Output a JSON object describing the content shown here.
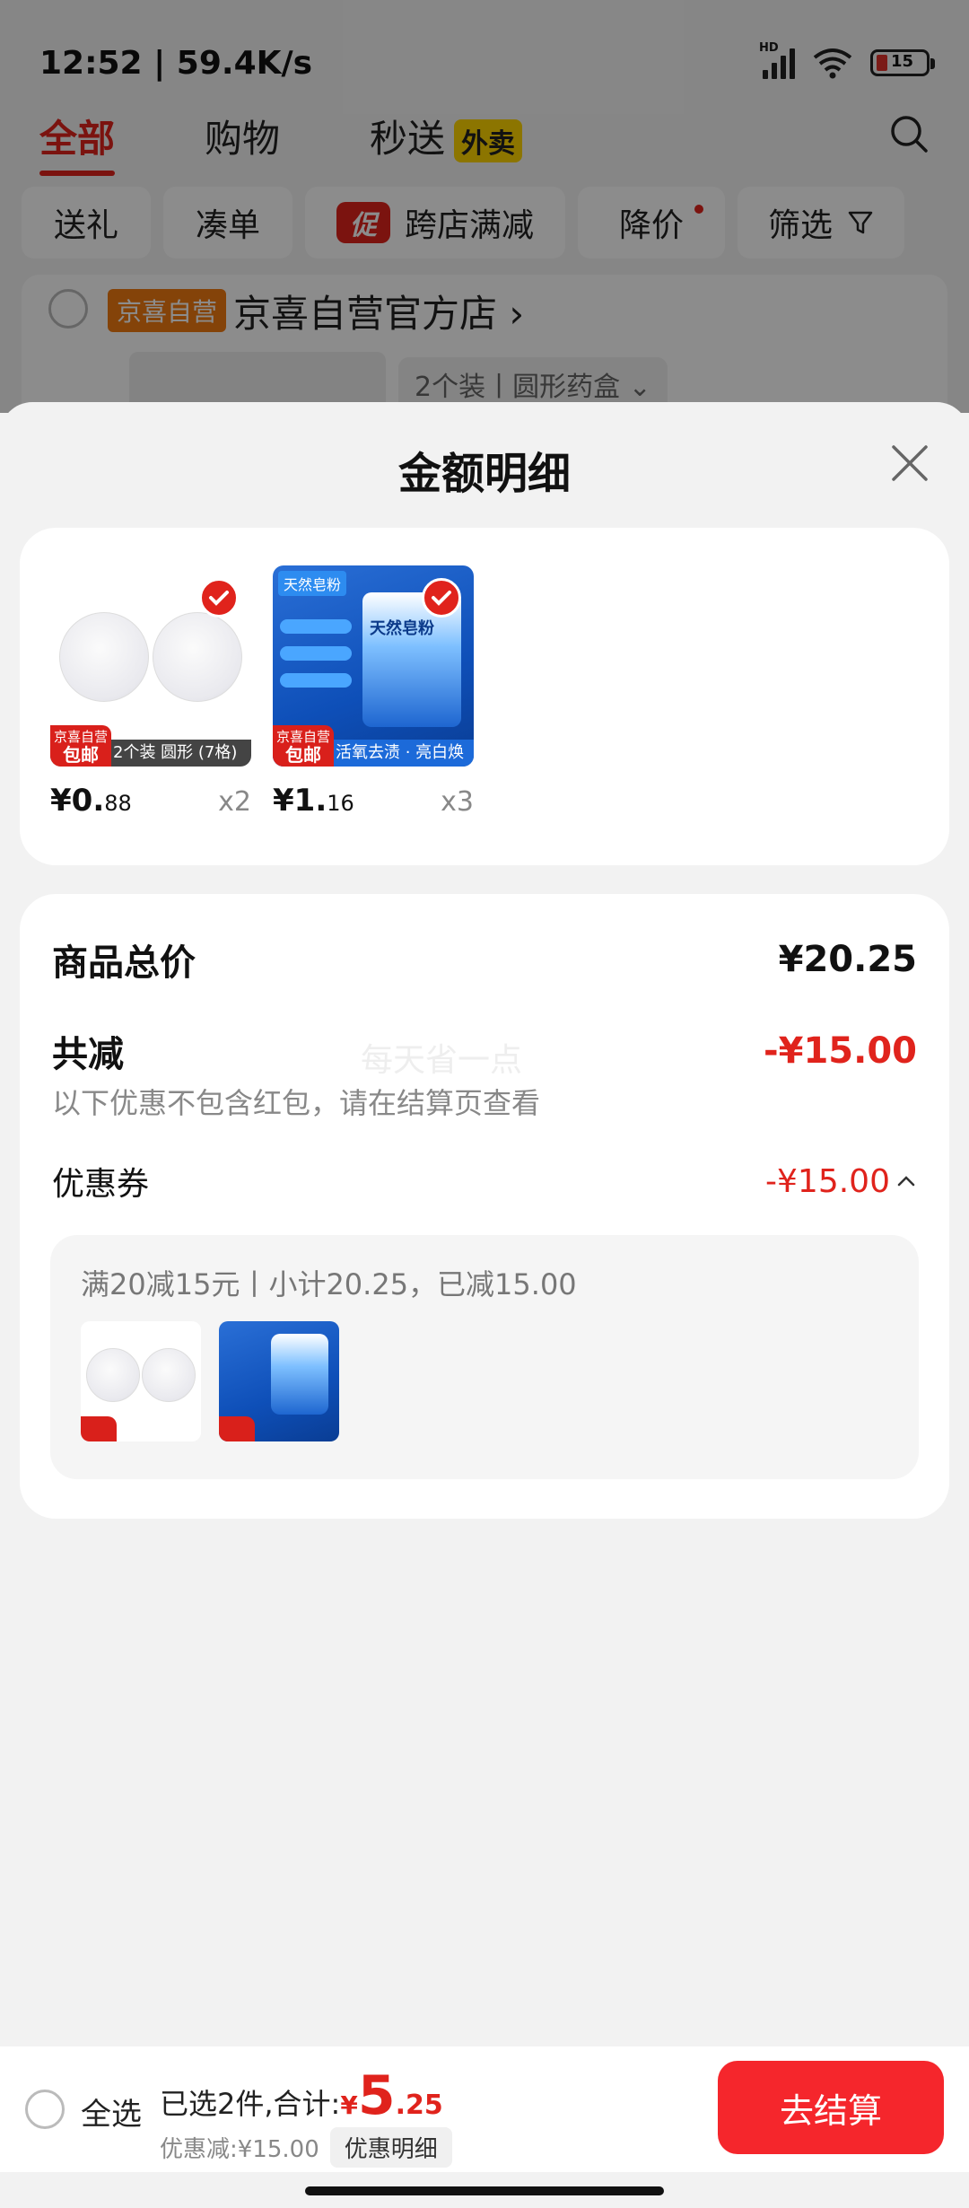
{
  "status_bar": {
    "time": "12:52 | 59.4K/s",
    "battery": "15",
    "hd": "HD"
  },
  "tabs": [
    {
      "label": "全部",
      "active": true
    },
    {
      "label": "购物",
      "active": false
    },
    {
      "label": "秒送",
      "active": false,
      "badge": "外卖"
    }
  ],
  "filters": [
    "送礼",
    "凑单",
    "跨店满减",
    "降价",
    "筛选"
  ],
  "promo_badge": "促",
  "store": {
    "tag": "京喜自营",
    "name": "京喜自营官方店 ›",
    "spec": "2个装丨圆形药盒 ⌄"
  },
  "sheet": {
    "title": "金额明细",
    "items": [
      {
        "price_int": "¥0.",
        "price_dec": "88",
        "qty": "x2",
        "caption": "2个装 圆形 (7格)",
        "badge_top": "京喜自营",
        "badge_bottom": "包邮"
      },
      {
        "price_int": "¥1.",
        "price_dec": "16",
        "qty": "x3",
        "caption": "活氧去渍 · 亮白焕新",
        "badge_top": "京喜自营",
        "badge_bottom": "包邮",
        "tag": "天然皂粉",
        "bag_title": "天然皂粉"
      }
    ],
    "summary": {
      "total_label": "商品总价",
      "total_value": "¥20.25",
      "discount_label": "共减",
      "discount_value": "-¥15.00",
      "note": "以下优惠不包含红包，请在结算页查看",
      "watermark": "每天省一点",
      "coupon_label": "优惠券",
      "coupon_value": "-¥15.00",
      "coupon_detail": "满20减15元丨小计20.25，已减15.00"
    }
  },
  "bottom_bar": {
    "select_all": "全选",
    "selected_text": "已选2件,合计:",
    "total_yen": "¥",
    "total_int": "5",
    "total_dec": ".25",
    "discount_text": "优惠减:¥15.00",
    "detail_label": "优惠明细",
    "checkout_label": "去结算"
  },
  "colors": {
    "accent": "#e0231c",
    "checkout": "#f5262c",
    "tag_orange": "#f07a12",
    "waimai_yellow": "#ffd500"
  }
}
